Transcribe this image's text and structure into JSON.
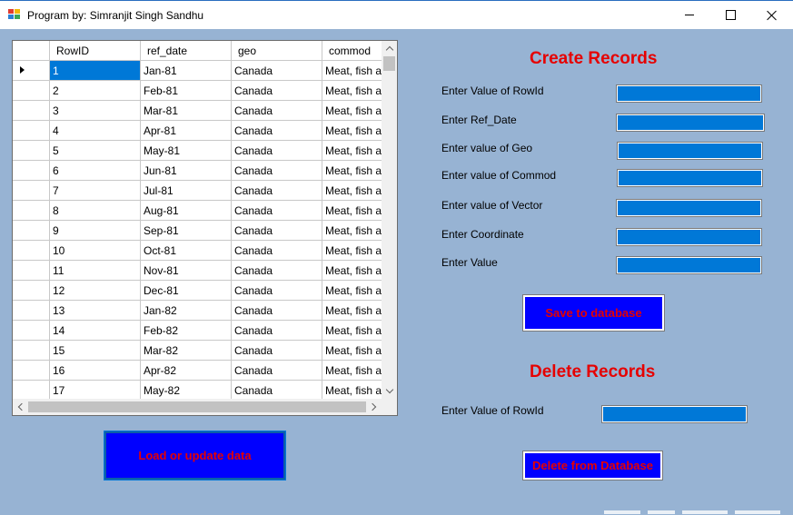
{
  "window": {
    "title": "Program by: Simranjit Singh Sandhu",
    "icon": "app-window-icon"
  },
  "grid": {
    "columns": [
      "RowID",
      "ref_date",
      "geo",
      "commod"
    ],
    "selected_row_index": 0,
    "rows": [
      [
        "1",
        "Jan-81",
        "Canada",
        "Meat, fish and"
      ],
      [
        "2",
        "Feb-81",
        "Canada",
        "Meat, fish and"
      ],
      [
        "3",
        "Mar-81",
        "Canada",
        "Meat, fish and"
      ],
      [
        "4",
        "Apr-81",
        "Canada",
        "Meat, fish and"
      ],
      [
        "5",
        "May-81",
        "Canada",
        "Meat, fish and"
      ],
      [
        "6",
        "Jun-81",
        "Canada",
        "Meat, fish and"
      ],
      [
        "7",
        "Jul-81",
        "Canada",
        "Meat, fish and"
      ],
      [
        "8",
        "Aug-81",
        "Canada",
        "Meat, fish and"
      ],
      [
        "9",
        "Sep-81",
        "Canada",
        "Meat, fish and"
      ],
      [
        "10",
        "Oct-81",
        "Canada",
        "Meat, fish and"
      ],
      [
        "11",
        "Nov-81",
        "Canada",
        "Meat, fish and"
      ],
      [
        "12",
        "Dec-81",
        "Canada",
        "Meat, fish and"
      ],
      [
        "13",
        "Jan-82",
        "Canada",
        "Meat, fish and"
      ],
      [
        "14",
        "Feb-82",
        "Canada",
        "Meat, fish and"
      ],
      [
        "15",
        "Mar-82",
        "Canada",
        "Meat, fish and"
      ],
      [
        "16",
        "Apr-82",
        "Canada",
        "Meat, fish and"
      ],
      [
        "17",
        "May-82",
        "Canada",
        "Meat, fish and"
      ]
    ]
  },
  "create": {
    "heading": "Create Records",
    "fields": [
      {
        "label": "Enter Value of RowId",
        "value": ""
      },
      {
        "label": "Enter Ref_Date",
        "value": ""
      },
      {
        "label": "Enter value of Geo",
        "value": ""
      },
      {
        "label": "Enter value of Commod",
        "value": ""
      },
      {
        "label": "Enter value of Vector",
        "value": ""
      },
      {
        "label": "Enter Coordinate",
        "value": ""
      },
      {
        "label": "Enter Value",
        "value": ""
      }
    ],
    "save_button": "Save to database"
  },
  "delete": {
    "heading": "Delete Records",
    "field_label": "Enter Value of RowId",
    "field_value": "",
    "delete_button": "Delete from Database"
  },
  "load_button": "Load or update data",
  "colors": {
    "form_background": "#97b3d3",
    "heading_red": "#e60000",
    "button_blue": "#0000ff",
    "textbox_blue": "#0078d7",
    "selection_blue": "#0078d7"
  }
}
